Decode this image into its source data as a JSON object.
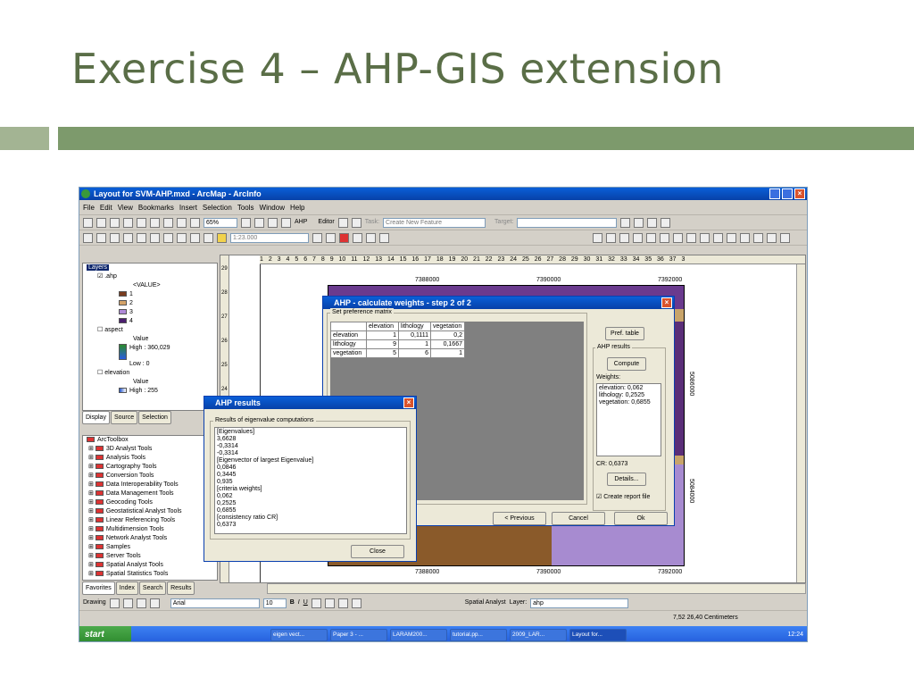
{
  "slide": {
    "title": "Exercise 4 – AHP-GIS extension"
  },
  "app": {
    "title": "Layout for SVM-AHP.mxd - ArcMap - ArcInfo"
  },
  "menu": [
    "File",
    "Edit",
    "View",
    "Bookmarks",
    "Insert",
    "Selection",
    "Tools",
    "Window",
    "Help"
  ],
  "toolbar": {
    "zoom": "65%",
    "ahp_label": "AHP",
    "editor_label": "Editor",
    "task_label": "Task:",
    "task_value": "Create New Feature",
    "target_label": "Target:",
    "scale": "1:23.000"
  },
  "toc": {
    "layers_label": "Layers",
    "items": [
      {
        "label": ".ahp"
      },
      {
        "label": "<VALUE>"
      },
      {
        "label": "1",
        "color": "#7a3c1e"
      },
      {
        "label": "2",
        "color": "#d4a36a"
      },
      {
        "label": "3",
        "color": "#b08ad8"
      },
      {
        "label": "4",
        "color": "#4b1e6e"
      },
      {
        "label": "aspect"
      },
      {
        "label": "Value"
      },
      {
        "label": "High : 360,029"
      },
      {
        "label": "Low : 0"
      },
      {
        "label": "elevation"
      },
      {
        "label": "Value"
      },
      {
        "label": "High : 255"
      }
    ],
    "tabs": [
      "Display",
      "Source",
      "Selection"
    ]
  },
  "toolbox": {
    "title": "ArcToolbox",
    "items": [
      "3D Analyst Tools",
      "Analysis Tools",
      "Cartography Tools",
      "Conversion Tools",
      "Data Interoperability Tools",
      "Data Management Tools",
      "Geocoding Tools",
      "Geostatistical Analyst Tools",
      "Linear Referencing Tools",
      "Multidimension Tools",
      "Network Analyst Tools",
      "Samples",
      "Server Tools",
      "Spatial Analyst Tools",
      "Spatial Statistics Tools"
    ],
    "tabs": [
      "Favorites",
      "Index",
      "Search",
      "Results"
    ]
  },
  "map": {
    "ruler_top": "1 2 3 4 5 6 7 8 9 10 11 12 13 14 15 16 17 18 19 20 21 22 23 24 25 26 27 28 29 30 31 32 33 34 35 36 37 3",
    "coord_top": [
      "7388000",
      "7390000",
      "7392000"
    ],
    "coord_bottom": [
      "7388000",
      "7390000",
      "7392000"
    ],
    "coord_right": [
      "5086000",
      "5084000"
    ],
    "ruler_left": [
      "29",
      "28",
      "27",
      "26",
      "25",
      "24",
      "23",
      "22",
      "21",
      "20",
      "19",
      "18",
      "17"
    ]
  },
  "dialog_weights": {
    "title": "AHP - calculate weights - step 2 of 2",
    "group_label": "Set preference matrix",
    "headers": [
      "",
      "elevation",
      "lithology",
      "vegetation"
    ],
    "rows": [
      [
        "elevation",
        "1",
        "0,1111",
        "0,2"
      ],
      [
        "lithology",
        "9",
        "1",
        "0,1667"
      ],
      [
        "vegetation",
        "5",
        "6",
        "1"
      ]
    ],
    "pref_button": "Pref. table",
    "results_label": "AHP results",
    "compute_button": "Compute",
    "weights_label": "Weights:",
    "weights_lines": [
      "elevation: 0,062",
      "lithology: 0,2525",
      "vegetation: 0,6855"
    ],
    "cr_label": "CR: 0,6373",
    "details_button": "Details...",
    "report_label": "Create report file",
    "prev_button": "< Previous",
    "cancel_button": "Cancel",
    "ok_button": "Ok"
  },
  "dialog_results": {
    "title": "AHP results",
    "group_label": "Results of eigenvalue computations",
    "lines": [
      "[Eigenvalues]",
      "3,6628",
      "-0,3314",
      "-0,3314",
      "[Eigenvector of largest Eigenvalue]",
      "0,0846",
      "0,3445",
      "0,935",
      "[criteria weights]",
      "0,062",
      "0,2525",
      "0,6855",
      "[consistency ratio CR]",
      "0,6373"
    ],
    "close_button": "Close"
  },
  "drawing": {
    "drawing_label": "Drawing",
    "font": "Arial",
    "size": "10",
    "bold": "B",
    "italic": "I",
    "underline": "U",
    "spatial_label": "Spatial Analyst",
    "layer_label": "Layer:",
    "layer_value": "ahp"
  },
  "status": {
    "coords": "7,52  26,40 Centimeters"
  },
  "taskbar": {
    "start": "start",
    "items": [
      "eigen vect...",
      "Paper 3 - ...",
      "LARAM200...",
      "tutorial.pp...",
      "2009_LAR...",
      "Layout for..."
    ],
    "clock": "12:24"
  }
}
